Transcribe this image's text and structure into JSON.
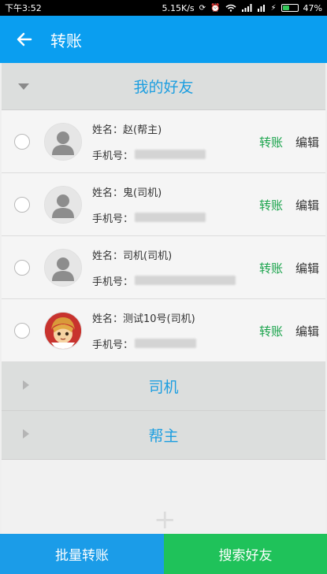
{
  "status_bar": {
    "time": "下午3:52",
    "network_speed": "5.15K/s",
    "battery": "47%",
    "battery_fraction": 0.47
  },
  "app_bar": {
    "title": "转账",
    "back_icon": "back-arrow-icon"
  },
  "groups": [
    {
      "title": "我的好友",
      "expanded": true,
      "members": [
        {
          "name_label": "姓名：",
          "name": "赵(帮主)",
          "phone_label": "手机号：",
          "transfer": "转账",
          "edit": "编辑",
          "avatar": "default-avatar"
        },
        {
          "name_label": "姓名：",
          "name": "鬼(司机)",
          "phone_label": "手机号：",
          "transfer": "转账",
          "edit": "编辑",
          "avatar": "default-avatar"
        },
        {
          "name_label": "姓名：",
          "name": "司机(司机)",
          "phone_label": "手机号：",
          "transfer": "转账",
          "edit": "编辑",
          "avatar": "default-avatar"
        },
        {
          "name_label": "姓名：",
          "name": "测试10号(司机)",
          "phone_label": "手机号：",
          "transfer": "转账",
          "edit": "编辑",
          "avatar": "cartoon-avatar"
        }
      ]
    },
    {
      "title": "司机",
      "expanded": false
    },
    {
      "title": "帮主",
      "expanded": false
    }
  ],
  "bottom_bar": {
    "left_label": "批量转账",
    "right_label": "搜索好友"
  },
  "colors": {
    "primary": "#0a9ef0",
    "green": "#1fc25a",
    "transfer_text": "#19a34b"
  }
}
